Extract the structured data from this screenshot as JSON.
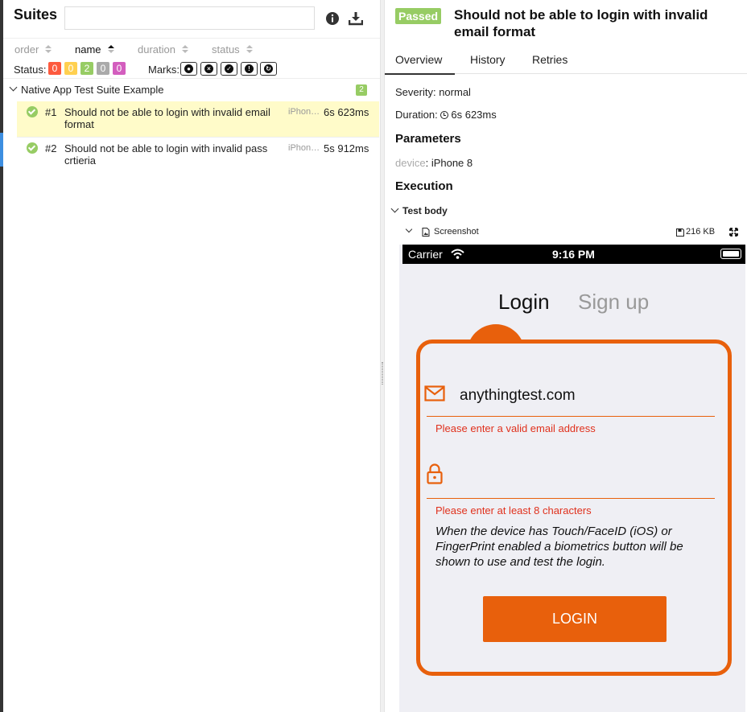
{
  "left": {
    "title": "Suites",
    "search": {
      "value": "",
      "placeholder": ""
    },
    "sort": [
      {
        "label": "order"
      },
      {
        "label": "name"
      },
      {
        "label": "duration"
      },
      {
        "label": "status"
      }
    ],
    "status_label": "Status:",
    "status_counts": [
      {
        "value": "0",
        "color": "#fd5a3e"
      },
      {
        "value": "0",
        "color": "#ffd050"
      },
      {
        "value": "2",
        "color": "#97cc64"
      },
      {
        "value": "0",
        "color": "#aaaaaa"
      },
      {
        "value": "0",
        "color": "#d35ebe"
      }
    ],
    "marks_label": "Marks:",
    "group": {
      "title": "Native App Test Suite Example",
      "count": "2"
    },
    "tests": [
      {
        "num": "#1",
        "name": "Should not be able to login with invalid email format",
        "param": "iPhon…",
        "duration": "6s 623ms"
      },
      {
        "num": "#2",
        "name": "Should not be able to login with invalid pass crtieria",
        "param": "iPhon…",
        "duration": "5s 912ms"
      }
    ]
  },
  "right": {
    "status": "Passed",
    "title": "Should not be able to login with invalid email format",
    "tabs": [
      "Overview",
      "History",
      "Retries"
    ],
    "severity_label": "Severity:",
    "severity_value": "normal",
    "duration_label": "Duration:",
    "duration_value": "6s 623ms",
    "parameters_heading": "Parameters",
    "param_key": "device",
    "param_value": "iPhone 8",
    "execution_heading": "Execution",
    "step": "Test body",
    "attachment": {
      "name": "Screenshot",
      "size": "216 KB"
    }
  },
  "phone": {
    "carrier": "Carrier",
    "time": "9:16 PM",
    "tab_login": "Login",
    "tab_signup": "Sign up",
    "email_value": "anythingtest.com",
    "email_error": "Please enter a valid email address",
    "password_error": "Please enter at least 8 characters",
    "note": "When the device has Touch/FaceID (iOS) or FingerPrint enabled a biometrics button will be shown to use and test the login.",
    "login_button": "LOGIN",
    "accent": "#e8600c"
  }
}
